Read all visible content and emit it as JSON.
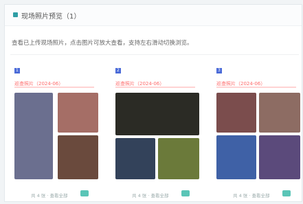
{
  "header": {
    "title": "现场照片预览（1）"
  },
  "description": "查看已上传现场照片，点击图片可放大查看，支持左右滑动切换浏览。",
  "cards": [
    {
      "tag": "1",
      "red_text": "巡查照片（2024-06）",
      "footer_text": "共 4 张 · 查看全部",
      "photo_colors": [
        "#6b6f8f",
        "#a56e66",
        "#2c3a4f",
        "#6a4a3d"
      ]
    },
    {
      "tag": "2",
      "red_text": "巡查照片（2024-06）",
      "footer_text": "共 4 张 · 查看全部",
      "photo_colors": [
        "#2b2b25",
        "#8c8a4f",
        "#33425a",
        "#6b7a3a"
      ]
    },
    {
      "tag": "3",
      "red_text": "巡查照片（2024-06）",
      "footer_text": "共 4 张 · 查看全部",
      "photo_colors": [
        "#7b4d4d",
        "#8d6c63",
        "#3f61a6",
        "#5b4a7b"
      ]
    }
  ]
}
